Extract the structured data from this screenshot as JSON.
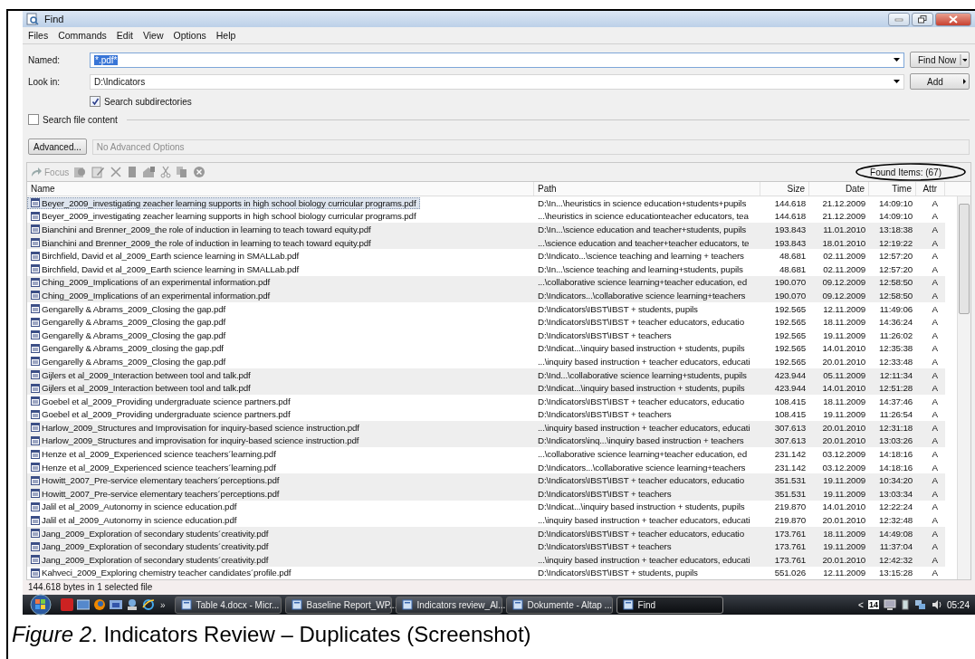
{
  "window": {
    "title": "Find"
  },
  "menu": [
    "Files",
    "Commands",
    "Edit",
    "View",
    "Options",
    "Help"
  ],
  "named": {
    "label": "Named:",
    "value": "*.pdf*",
    "text_selected": true
  },
  "look_in": {
    "label": "Look in:",
    "value": "D:\\Indicators"
  },
  "buttons": {
    "find_now": "Find Now",
    "add": "Add",
    "advanced": "Advanced..."
  },
  "search_subdirectories": {
    "label": "Search subdirectories",
    "checked": true
  },
  "search_file_content": {
    "label": "Search file content",
    "checked": false
  },
  "advanced_options": {
    "value": "No Advanced Options",
    "disabled": true
  },
  "toolbar": {
    "focus": "Focus",
    "disabled": true
  },
  "found_items": "Found Items: (67)",
  "columns": [
    "Name",
    "Path",
    "Size",
    "Date",
    "Time",
    "Attr"
  ],
  "groups": [
    {
      "rows": [
        {
          "name": "Beyer_2009_investigating zeacher learning supports in high school biology curricular programs.pdf",
          "path": "D:\\In...\\heuristics in science education+students+pupils",
          "size": "144.618",
          "date": "21.12.2009",
          "time": "14:09:10",
          "attr": "A",
          "selected": true
        },
        {
          "name": "Beyer_2009_investigating zeacher learning supports in high school biology curricular programs.pdf",
          "path": "...\\heuristics in science educationteacher educators, tea",
          "size": "144.618",
          "date": "21.12.2009",
          "time": "14:09:10",
          "attr": "A",
          "selected": false
        }
      ]
    },
    {
      "rows": [
        {
          "name": "Bianchini and Brenner_2009_the role of induction in learning to teach toward equity.pdf",
          "path": "D:\\In...\\science education and teacher+students, pupils",
          "size": "193.843",
          "date": "11.01.2010",
          "time": "13:18:38",
          "attr": "A",
          "selected": false
        },
        {
          "name": "Bianchini and Brenner_2009_the role of induction in learning to teach toward equity.pdf",
          "path": "...\\science education and teacher+teacher educators, te",
          "size": "193.843",
          "date": "18.01.2010",
          "time": "12:19:22",
          "attr": "A",
          "selected": false
        }
      ]
    },
    {
      "rows": [
        {
          "name": "Birchfield, David et al_2009_Earth science learning in SMALLab.pdf",
          "path": "D:\\Indicato...\\science teaching and learning + teachers",
          "size": "48.681",
          "date": "02.11.2009",
          "time": "12:57:20",
          "attr": "A",
          "selected": false
        },
        {
          "name": "Birchfield, David et al_2009_Earth science learning in SMALLab.pdf",
          "path": "D:\\In...\\science teaching and learning+students, pupils",
          "size": "48.681",
          "date": "02.11.2009",
          "time": "12:57:20",
          "attr": "A",
          "selected": false
        }
      ]
    },
    {
      "rows": [
        {
          "name": "Ching_2009_Implications of an experimental information.pdf",
          "path": "...\\collaborative science learning+teacher education, ed",
          "size": "190.070",
          "date": "09.12.2009",
          "time": "12:58:50",
          "attr": "A",
          "selected": false
        },
        {
          "name": "Ching_2009_Implications of an experimental information.pdf",
          "path": "D:\\Indicators...\\collaborative science learning+teachers",
          "size": "190.070",
          "date": "09.12.2009",
          "time": "12:58:50",
          "attr": "A",
          "selected": false
        }
      ]
    },
    {
      "rows": [
        {
          "name": "Gengarelly & Abrams_2009_Closing the gap.pdf",
          "path": "D:\\Indicators\\IBST\\IBST + students, pupils",
          "size": "192.565",
          "date": "12.11.2009",
          "time": "11:49:06",
          "attr": "A",
          "selected": false
        },
        {
          "name": "Gengarelly & Abrams_2009_Closing the gap.pdf",
          "path": "D:\\Indicators\\IBST\\IBST + teacher educators, educatio",
          "size": "192.565",
          "date": "18.11.2009",
          "time": "14:36:24",
          "attr": "A",
          "selected": false
        },
        {
          "name": "Gengarelly & Abrams_2009_Closing the gap.pdf",
          "path": "D:\\Indicators\\IBST\\IBST + teachers",
          "size": "192.565",
          "date": "19.11.2009",
          "time": "11:26:02",
          "attr": "A",
          "selected": false
        },
        {
          "name": "Gengarelly & Abrams_2009_closing the gap.pdf",
          "path": "D:\\Indicat...\\inquiry based instruction + students, pupils",
          "size": "192.565",
          "date": "14.01.2010",
          "time": "12:35:38",
          "attr": "A",
          "selected": false
        },
        {
          "name": "Gengarelly & Abrams_2009_Closing the gap.pdf",
          "path": "...\\inquiry based instruction + teacher educators, educati",
          "size": "192.565",
          "date": "20.01.2010",
          "time": "12:33:48",
          "attr": "A",
          "selected": false
        }
      ]
    },
    {
      "rows": [
        {
          "name": "Gijlers et al_2009_Interaction between tool and talk.pdf",
          "path": "D:\\Ind...\\collaborative science learning+students, pupils",
          "size": "423.944",
          "date": "05.11.2009",
          "time": "12:11:34",
          "attr": "A",
          "selected": false
        },
        {
          "name": "Gijlers et al_2009_Interaction between tool and talk.pdf",
          "path": "D:\\Indicat...\\inquiry based instruction + students, pupils",
          "size": "423.944",
          "date": "14.01.2010",
          "time": "12:51:28",
          "attr": "A",
          "selected": false
        }
      ]
    },
    {
      "rows": [
        {
          "name": "Goebel et al_2009_Providing undergraduate science partners.pdf",
          "path": "D:\\Indicators\\IBST\\IBST + teacher educators, educatio",
          "size": "108.415",
          "date": "18.11.2009",
          "time": "14:37:46",
          "attr": "A",
          "selected": false
        },
        {
          "name": "Goebel et al_2009_Providing undergraduate science partners.pdf",
          "path": "D:\\Indicators\\IBST\\IBST + teachers",
          "size": "108.415",
          "date": "19.11.2009",
          "time": "11:26:54",
          "attr": "A",
          "selected": false
        }
      ]
    },
    {
      "rows": [
        {
          "name": "Harlow_2009_Structures and Improvisation for inquiry-based science instruction.pdf",
          "path": "...\\inquiry based instruction + teacher educators, educati",
          "size": "307.613",
          "date": "20.01.2010",
          "time": "12:31:18",
          "attr": "A",
          "selected": false
        },
        {
          "name": "Harlow_2009_Structures and improvisation for inquiry-based science instruction.pdf",
          "path": "D:\\Indicators\\inq...\\inquiry based instruction + teachers",
          "size": "307.613",
          "date": "20.01.2010",
          "time": "13:03:26",
          "attr": "A",
          "selected": false
        }
      ]
    },
    {
      "rows": [
        {
          "name": "Henze et al_2009_Experienced science teachers´learning.pdf",
          "path": "...\\collaborative science learning+teacher education, ed",
          "size": "231.142",
          "date": "03.12.2009",
          "time": "14:18:16",
          "attr": "A",
          "selected": false
        },
        {
          "name": "Henze et al_2009_Experienced science teachers´learning.pdf",
          "path": "D:\\Indicators...\\collaborative science learning+teachers",
          "size": "231.142",
          "date": "03.12.2009",
          "time": "14:18:16",
          "attr": "A",
          "selected": false
        }
      ]
    },
    {
      "rows": [
        {
          "name": "Howitt_2007_Pre-service elementary teachers´perceptions.pdf",
          "path": "D:\\Indicators\\IBST\\IBST + teacher educators, educatio",
          "size": "351.531",
          "date": "19.11.2009",
          "time": "10:34:20",
          "attr": "A",
          "selected": false
        },
        {
          "name": "Howitt_2007_Pre-service elementary teachers´perceptions.pdf",
          "path": "D:\\Indicators\\IBST\\IBST + teachers",
          "size": "351.531",
          "date": "19.11.2009",
          "time": "13:03:34",
          "attr": "A",
          "selected": false
        }
      ]
    },
    {
      "rows": [
        {
          "name": "Jalil et al_2009_Autonomy in science education.pdf",
          "path": "D:\\Indicat...\\inquiry based instruction + students, pupils",
          "size": "219.870",
          "date": "14.01.2010",
          "time": "12:22:24",
          "attr": "A",
          "selected": false
        },
        {
          "name": "Jalil et al_2009_Autonomy in science education.pdf",
          "path": "...\\inquiry based instruction + teacher educators, educati",
          "size": "219.870",
          "date": "20.01.2010",
          "time": "12:32:48",
          "attr": "A",
          "selected": false
        }
      ]
    },
    {
      "rows": [
        {
          "name": "Jang_2009_Exploration of secondary students´creativity.pdf",
          "path": "D:\\Indicators\\IBST\\IBST + teacher educators, educatio",
          "size": "173.761",
          "date": "18.11.2009",
          "time": "14:49:08",
          "attr": "A",
          "selected": false
        },
        {
          "name": "Jang_2009_Exploration of secondary students´creativity.pdf",
          "path": "D:\\Indicators\\IBST\\IBST + teachers",
          "size": "173.761",
          "date": "19.11.2009",
          "time": "11:37:04",
          "attr": "A",
          "selected": false
        },
        {
          "name": "Jang_2009_Exploration of secondary students´creativity.pdf",
          "path": "...\\inquiry based instruction + teacher educators, educati",
          "size": "173.761",
          "date": "20.01.2010",
          "time": "12:42:32",
          "attr": "A",
          "selected": false
        }
      ]
    },
    {
      "rows": [
        {
          "name": "Kahveci_2009_Exploring chemistry teacher candidates´profile.pdf",
          "path": "D:\\Indicators\\IBST\\IBST + students, pupils",
          "size": "551.026",
          "date": "12.11.2009",
          "time": "13:15:28",
          "attr": "A",
          "selected": false
        }
      ]
    }
  ],
  "status_bar": "144.618 bytes in 1 selected file",
  "taskbar": {
    "tasks": [
      {
        "label": "Table 4.docx - Micr...",
        "selected": false
      },
      {
        "label": "Baseline Report_WP...",
        "selected": false
      },
      {
        "label": "Indicators review_Al...",
        "selected": false
      },
      {
        "label": "Dokumente - Altap ...",
        "selected": false
      },
      {
        "label": "Find",
        "selected": true
      }
    ],
    "more": "»",
    "tray_arrow": "<",
    "calendar_day": "14",
    "clock": "05:24"
  },
  "caption": "*Figure 2*. Indicators Review – Duplicates (Screenshot)"
}
